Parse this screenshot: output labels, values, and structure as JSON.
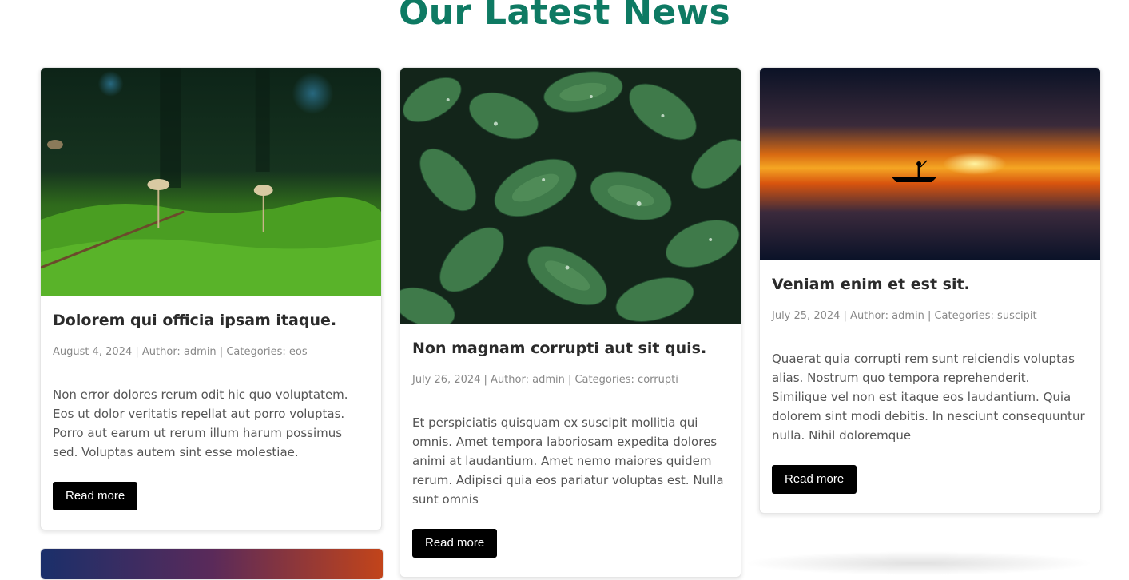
{
  "section": {
    "title": "Our Latest News"
  },
  "posts": [
    {
      "title": "Dolorem qui officia ipsam itaque.",
      "meta": "August 4, 2024 | Author: admin | Categories: eos",
      "excerpt": "Non error dolores rerum odit hic quo voluptatem. Eos ut dolor veritatis repellat aut porro voluptas. Porro aut earum ut rerum illum harum possimus sed. Voluptas autem sint esse molestiae.",
      "button": "Read more",
      "image": "mossy-forest-mushrooms-photo"
    },
    {
      "title": "Non magnam corrupti aut sit quis.",
      "meta": "July 26, 2024 | Author: admin | Categories: corrupti",
      "excerpt": "Et perspiciatis quisquam ex suscipit mollitia qui omnis. Amet tempora laboriosam expedita dolores animi at laudantium. Amet nemo maiores quidem rerum. Adipisci quia eos pariatur voluptas est. Nulla sunt omnis",
      "button": "Read more",
      "image": "green-leaves-dew-photo"
    },
    {
      "title": "Veniam enim et est sit.",
      "meta": "July 25, 2024 | Author: admin | Categories: suscipit",
      "excerpt": "Quaerat quia corrupti rem sunt reiciendis voluptas alias. Nostrum quo tempora reprehenderit. Similique vel non est itaque eos laudantium. Quia dolorem sint modi debitis. In nesciunt consequuntur nulla. Nihil doloremque",
      "button": "Read more",
      "image": "sunset-boat-lake-photo"
    }
  ],
  "colors": {
    "accent": "#0e7a63",
    "button_bg": "#000000",
    "meta": "#888888"
  }
}
